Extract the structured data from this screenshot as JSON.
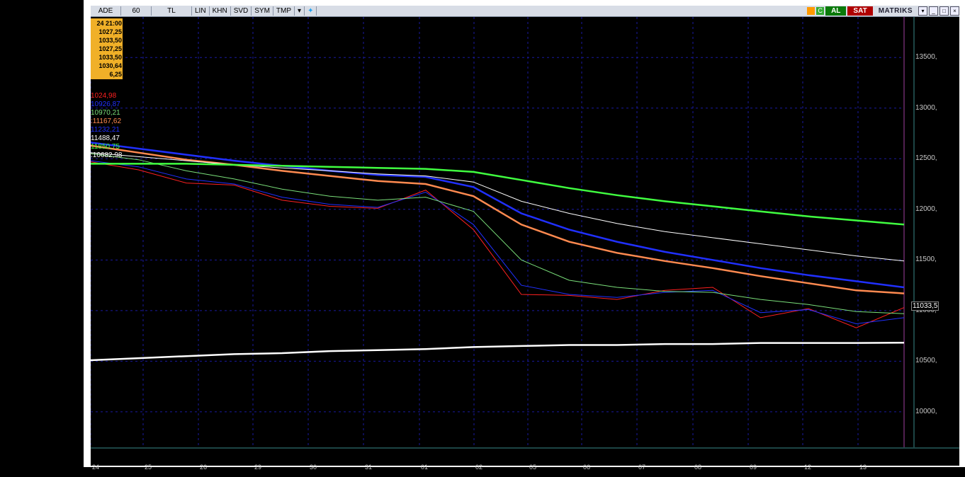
{
  "toolbar": {
    "period_label": "ADE",
    "interval": "60",
    "currency": "TL",
    "scale": "LIN",
    "btn_khn": "KHN",
    "btn_svd": "SVD",
    "btn_sym": "SYM",
    "btn_tmp": "TMP",
    "buy_label": "AL",
    "sell_label": "SAT",
    "brand": "MATRIKS"
  },
  "ohlc_box": [
    "24 21:00",
    "1027,25",
    "1033,50",
    "1027,25",
    "1033,50",
    "1030,64",
    "6,25"
  ],
  "indicators": [
    {
      "text": "1024,98",
      "color": "#ff2020"
    },
    {
      "text": "10926,87",
      "color": "#2030ff"
    },
    {
      "text": "10970,21",
      "color": "#7adf7a"
    },
    {
      "text": ":11167,62",
      "color": "#ff8a50"
    },
    {
      "text": "11232,21",
      "color": "#2030ff"
    },
    {
      "text": "11488,47",
      "color": "#ffffff"
    },
    {
      "text": "11850,75",
      "color": "#40ff40"
    },
    {
      "text": ":10682,98",
      "color": "#ffffff"
    }
  ],
  "y_axis": [
    "13500,",
    "13000,",
    "12500,",
    "12000,",
    "11500,",
    "11000,",
    "10500,",
    "10000,"
  ],
  "x_axis": [
    "24",
    "25",
    "26",
    "29",
    "30",
    "31",
    "01",
    "02",
    "05",
    "06",
    "07",
    "08",
    "09",
    "12",
    "13"
  ],
  "last_price": "11033,5",
  "chart_data": {
    "type": "line",
    "y_ticks": [
      13500,
      13000,
      12500,
      12000,
      11500,
      11000,
      10500,
      10000
    ],
    "ylim": [
      9650,
      13900
    ],
    "x_categories": [
      "24",
      "25",
      "26",
      "29",
      "30",
      "31",
      "01",
      "02",
      "05",
      "06",
      "07",
      "08",
      "09",
      "12",
      "13"
    ],
    "series": [
      {
        "name": "",
        "color": "#ff2020",
        "values": [
          12470,
          12390,
          12260,
          12240,
          12090,
          12030,
          12010,
          12190,
          11800,
          11160,
          11150,
          11110,
          11200,
          11230,
          10930,
          11020,
          10830,
          11030
        ]
      },
      {
        "name": "",
        "color": "#2030ff",
        "values": [
          12480,
          12420,
          12300,
          12250,
          12120,
          12050,
          12020,
          12170,
          11850,
          11250,
          11160,
          11130,
          11180,
          11200,
          10980,
          11010,
          10870,
          10930
        ]
      },
      {
        "name": "",
        "color": "#7adf7a",
        "values": [
          12550,
          12490,
          12380,
          12300,
          12200,
          12130,
          12090,
          12120,
          11980,
          11500,
          11300,
          11230,
          11190,
          11180,
          11110,
          11060,
          10990,
          10970
        ]
      },
      {
        "name": "",
        "color": "#ff8a50",
        "values": [
          12630,
          12560,
          12490,
          12440,
          12380,
          12330,
          12280,
          12250,
          12130,
          11850,
          11680,
          11570,
          11490,
          11420,
          11340,
          11270,
          11200,
          11170
        ]
      },
      {
        "name": "",
        "color": "#2030ff",
        "values": [
          12660,
          12600,
          12540,
          12480,
          12430,
          12380,
          12340,
          12320,
          12220,
          11960,
          11800,
          11680,
          11580,
          11500,
          11420,
          11350,
          11290,
          11230
        ]
      },
      {
        "name": "",
        "color": "#ffffff",
        "values": [
          12560,
          12520,
          12480,
          12440,
          12410,
          12380,
          12350,
          12330,
          12270,
          12080,
          11960,
          11860,
          11780,
          11720,
          11660,
          11600,
          11540,
          11490
        ]
      },
      {
        "name": "",
        "color": "#40ff40",
        "values": [
          12450,
          12450,
          12450,
          12440,
          12430,
          12420,
          12410,
          12400,
          12370,
          12290,
          12210,
          12140,
          12080,
          12030,
          11980,
          11930,
          11890,
          11850
        ]
      },
      {
        "name": "",
        "color": "#ffffff",
        "values": [
          10510,
          10530,
          10550,
          10570,
          10580,
          10600,
          10610,
          10620,
          10640,
          10650,
          10660,
          10660,
          10670,
          10670,
          10680,
          10680,
          10680,
          10683
        ]
      }
    ],
    "grid": true
  }
}
